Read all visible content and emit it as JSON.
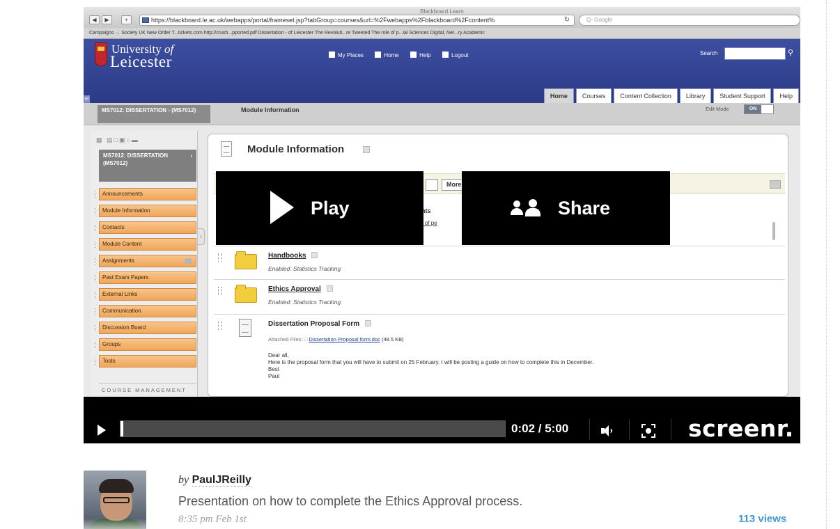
{
  "video": {
    "browser": {
      "window_title": "Blackboard Learn",
      "url": "https://blackboard.le.ac.uk/webapps/portal/frameset.jsp?tabGroup=courses&url=%2Fwebapps%2Fblackboard%2Fcontent%",
      "search_placeholder": "Q- Google",
      "bookmarks": "Campaigns →   Society UK   New Order T...tickets.com   http://crush...pported.pdf   Dissertation - of Leicester   The Revoluti...re Tweeted   The role of p...ial Sciences   Digital, Net...ry Academic"
    },
    "bb": {
      "university_line1": "University",
      "university_of": "of",
      "university_line2": "Leicester",
      "top_links": [
        "My Places",
        "Home",
        "Help",
        "Logout"
      ],
      "search_label": "Search",
      "tabs": [
        "Home",
        "Courses",
        "Content Collection",
        "Library",
        "Student Support",
        "Help"
      ],
      "course_chip": "MS7012: DISSERTATION - (MS7012)",
      "breadcrumb_title": "Module Information",
      "edit_mode_label": "Edit Mode",
      "edit_mode_value": "ON",
      "course_box": "MS7012: DISSERTATION (MS7012)",
      "menu": [
        "Announcements",
        "Module Information",
        "Contacts",
        "Module Content",
        "Assignments",
        "Past Exam Papers",
        "External Links",
        "Communication",
        "Discussion Board",
        "Groups",
        "Tools"
      ],
      "course_management": "COURSE MANAGEMENT",
      "page_heading": "Module Information",
      "more_button": "More",
      "students_peek": "udents",
      "students_link": "ssing of pe",
      "items": [
        {
          "title": "Handbooks",
          "meta": "Enabled: Statistics Tracking"
        },
        {
          "title": "Ethics Approval",
          "meta": "Enabled: Statistics Tracking"
        },
        {
          "title": "Dissertation Proposal Form",
          "attached_label": "Attached Files:",
          "file_name": "Dissertation Proposal form.doc",
          "file_size": "(48.5 KB)",
          "body": [
            "Dear all,",
            "Here is the proposal form that you will have to submit on 25 February. I will be posting a guide on how to complete this in December.",
            "Best",
            "Paul"
          ]
        }
      ]
    },
    "overlay": {
      "play_label": "Play",
      "share_label": "Share"
    },
    "player": {
      "time": "0:02 / 5:00",
      "progress": 0.0067,
      "brand": "screenr."
    }
  },
  "post": {
    "by": "by",
    "author": "PaulJReilly",
    "description": "Presentation on how to complete the Ethics Approval process.",
    "timestamp": "8:35 pm Feb 1st",
    "views": "113 views"
  }
}
